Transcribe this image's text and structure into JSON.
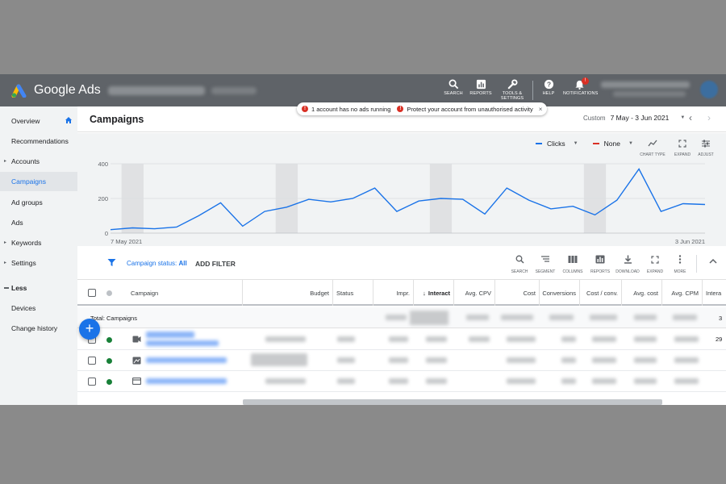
{
  "app": {
    "brand": "Google Ads",
    "toolbar": [
      {
        "label": "SEARCH",
        "icon": "search-icon"
      },
      {
        "label": "REPORTS",
        "icon": "reports-icon"
      },
      {
        "label": "TOOLS & SETTINGS",
        "icon": "wrench-icon"
      },
      {
        "label": "HELP",
        "icon": "help-icon"
      },
      {
        "label": "NOTIFICATIONS",
        "icon": "bell-icon",
        "badge": "!"
      }
    ]
  },
  "sidebar": {
    "items": [
      {
        "label": "Overview"
      },
      {
        "label": "Recommendations"
      },
      {
        "label": "Accounts"
      },
      {
        "label": "Campaigns"
      },
      {
        "label": "Ad groups"
      },
      {
        "label": "Ads"
      },
      {
        "label": "Keywords"
      },
      {
        "label": "Settings"
      },
      {
        "label": "Less"
      },
      {
        "label": "Devices"
      },
      {
        "label": "Change history"
      }
    ]
  },
  "header": {
    "title": "Campaigns",
    "alerts": [
      {
        "text": "1 account has no ads running",
        "icon": "!"
      },
      {
        "text": "Protect your account from unauthorised activity",
        "icon": "!"
      }
    ],
    "alert_close": "×",
    "date_label": "Custom",
    "date_value": "7 May - 3 Jun 2021"
  },
  "chart_controls": {
    "metric1": "Clicks",
    "metric2": "None",
    "tools": [
      {
        "label": "CHART TYPE",
        "icon": "chart-type-icon"
      },
      {
        "label": "EXPAND",
        "icon": "expand-icon"
      },
      {
        "label": "ADJUST",
        "icon": "adjust-icon"
      }
    ]
  },
  "chart_data": {
    "type": "line",
    "series": [
      {
        "name": "Clicks",
        "color": "#1a73e8",
        "values": [
          20,
          30,
          25,
          35,
          100,
          175,
          40,
          125,
          150,
          195,
          180,
          200,
          260,
          125,
          185,
          200,
          195,
          110,
          260,
          190,
          140,
          155,
          105,
          190,
          370,
          125,
          170,
          165
        ]
      }
    ],
    "x_start_label": "7 May 2021",
    "x_end_label": "3 Jun 2021",
    "yticks": [
      "400",
      "200",
      "0"
    ],
    "ylim": [
      0,
      400
    ],
    "grid": true,
    "shaded_bands": [
      1,
      8,
      15,
      22
    ]
  },
  "filterbar": {
    "filter_chip_prefix": "Campaign status: ",
    "filter_chip_value": "All",
    "add_filter": "ADD FILTER",
    "tools": [
      {
        "label": "SEARCH",
        "icon": "search-icon"
      },
      {
        "label": "SEGMENT",
        "icon": "segment-icon"
      },
      {
        "label": "COLUMNS",
        "icon": "columns-icon"
      },
      {
        "label": "REPORTS",
        "icon": "reports-icon"
      },
      {
        "label": "DOWNLOAD",
        "icon": "download-icon"
      },
      {
        "label": "EXPAND",
        "icon": "expand-icon"
      },
      {
        "label": "MORE",
        "icon": "more-icon"
      }
    ]
  },
  "table": {
    "columns": [
      "Campaign",
      "Budget",
      "Status",
      "Impr.",
      "Interact",
      "Avg. CPV",
      "Cost",
      "Conversions",
      "Cost / conv.",
      "Avg. cost",
      "Avg. CPM",
      "Intera"
    ],
    "sort_arrow": "↓",
    "total_label": "Total: Campaigns",
    "rows": [
      {
        "status_color": "#188038",
        "icon": "video-campaign-icon",
        "right_value": "29"
      },
      {
        "status_color": "#188038",
        "icon": "display-campaign-icon",
        "right_value": ""
      },
      {
        "status_color": "#188038",
        "icon": "search-campaign-icon",
        "right_value": ""
      }
    ],
    "total_right_value": "3"
  }
}
